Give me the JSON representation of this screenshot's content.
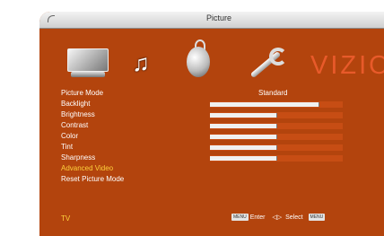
{
  "window": {
    "title": "Picture"
  },
  "brand": {
    "logo": "VIZIO",
    "accent_color": "#e85a2a"
  },
  "icons": [
    "tv-icon",
    "music-icon",
    "globe-icon",
    "wrench-icon"
  ],
  "menu": {
    "items": [
      "Picture Mode",
      "Backlight",
      "Brightness",
      "Contrast",
      "Color",
      "Tint",
      "Sharpness",
      "Advanced Video",
      "Reset Picture Mode"
    ],
    "selected": "Advanced Video",
    "picture_mode_value": "Standard"
  },
  "sliders": [
    {
      "name": "Backlight",
      "fill": 0.82
    },
    {
      "name": "Brightness",
      "fill": 0.5
    },
    {
      "name": "Contrast",
      "fill": 0.5
    },
    {
      "name": "Color",
      "fill": 0.5
    },
    {
      "name": "Tint",
      "fill": 0.5
    },
    {
      "name": "Sharpness",
      "fill": 0.5
    }
  ],
  "footer": {
    "input_label": "TV",
    "enter_key": "MENU",
    "enter_text": "Enter",
    "select_arrows": "◁▷",
    "select_text": "Select",
    "back_key": "MENU"
  }
}
